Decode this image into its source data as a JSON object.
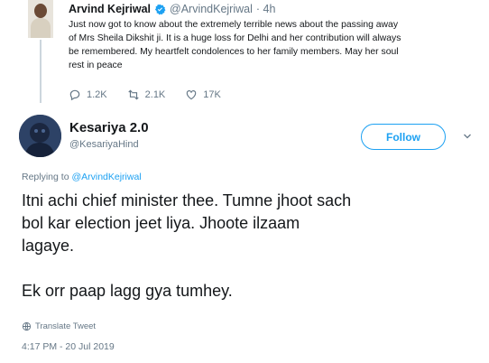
{
  "parent_tweet": {
    "name": "Arvind Kejriwal",
    "handle": "@ArvindKejriwal",
    "time": "· 4h",
    "lines": [
      "Just now got to know about the extremely terrible news about the passing away",
      "of Mrs Sheila Dikshit ji. It is a huge loss for Delhi and her contribution will always",
      "be remembered. My heartfelt condolences to her family members. May her soul",
      "rest in peace"
    ],
    "actions": {
      "replies": "1.2K",
      "retweets": "2.1K",
      "likes": "17K"
    },
    "verified_icon": "verified-badge-icon",
    "colors": {
      "verified": "#1da1f2"
    }
  },
  "tweet": {
    "name": "Kesariya 2.0",
    "handle": "@KesariyaHind",
    "follow_label": "Follow",
    "replying_prefix": "Replying to",
    "replying_to": "@ArvindKejriwal",
    "text_lines": [
      "Itni achi chief minister thee. Tumne jhoot sach",
      "bol kar election jeet liya. Jhoote ilzaam",
      "lagaye."
    ],
    "text_line_2": "Ek orr paap lagg gya tumhey.",
    "translate_label": "Translate Tweet",
    "timestamp": "4:17 PM - 20 Jul 2019"
  },
  "colors": {
    "accent": "#1da1f2",
    "muted": "#657786",
    "text": "#14171a"
  }
}
